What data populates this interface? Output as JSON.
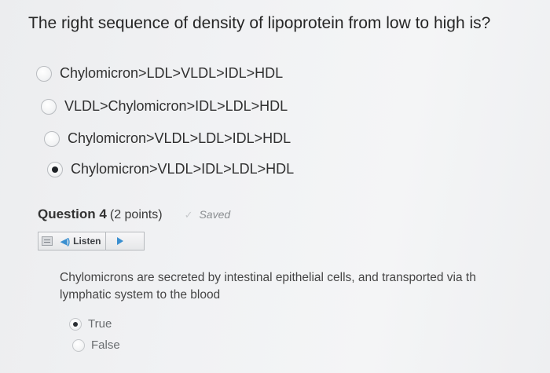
{
  "previous_question": {
    "title": "The right sequence of density of lipoprotein from low to high is?",
    "options": [
      {
        "label": "Chylomicron>LDL>VLDL>IDL>HDL",
        "selected": false
      },
      {
        "label": "VLDL>Chylomicron>IDL>LDL>HDL",
        "selected": false
      },
      {
        "label": "Chylomicron>VLDL>LDL>IDL>HDL",
        "selected": false
      },
      {
        "label": "Chylomicron>VLDL>IDL>LDL>HDL",
        "selected": true
      }
    ]
  },
  "question": {
    "label": "Question 4",
    "points": "(2 points)",
    "status": "Saved",
    "listen_label": "Listen",
    "text_line1": "Chylomicrons are secreted by intestinal epithelial cells, and transported via th",
    "text_line2": "lymphatic system to the blood",
    "answers": [
      {
        "label": "True",
        "selected": true
      },
      {
        "label": "False",
        "selected": false
      }
    ]
  },
  "icons": {
    "check": "check-icon",
    "document": "document-icon",
    "speaker": "speaker-icon",
    "play": "play-icon"
  },
  "colors": {
    "accent": "#3a8fd0",
    "background": "#f1f2f4"
  }
}
